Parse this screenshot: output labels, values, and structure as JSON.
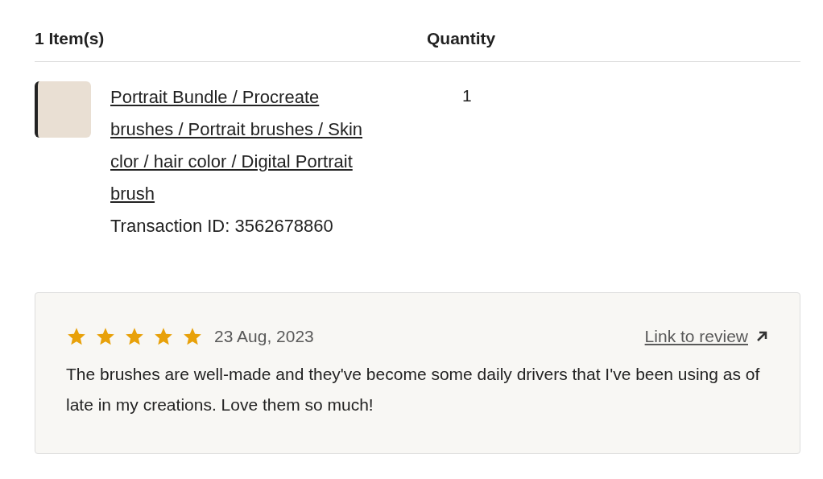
{
  "header": {
    "items_label": "1 Item(s)",
    "quantity_label": "Quantity"
  },
  "item": {
    "title": "Portrait Bundle / Procreate brushes / Portrait brushes / Skin clor / hair color / Digital Portrait brush",
    "transaction": "Transaction ID: 3562678860",
    "quantity": "1"
  },
  "review": {
    "stars": 5,
    "date": "23 Aug, 2023",
    "link": "Link to review",
    "text": "The brushes are well-made and they've become some daily drivers that I've been using as of late in my creations. Love them so much!"
  }
}
